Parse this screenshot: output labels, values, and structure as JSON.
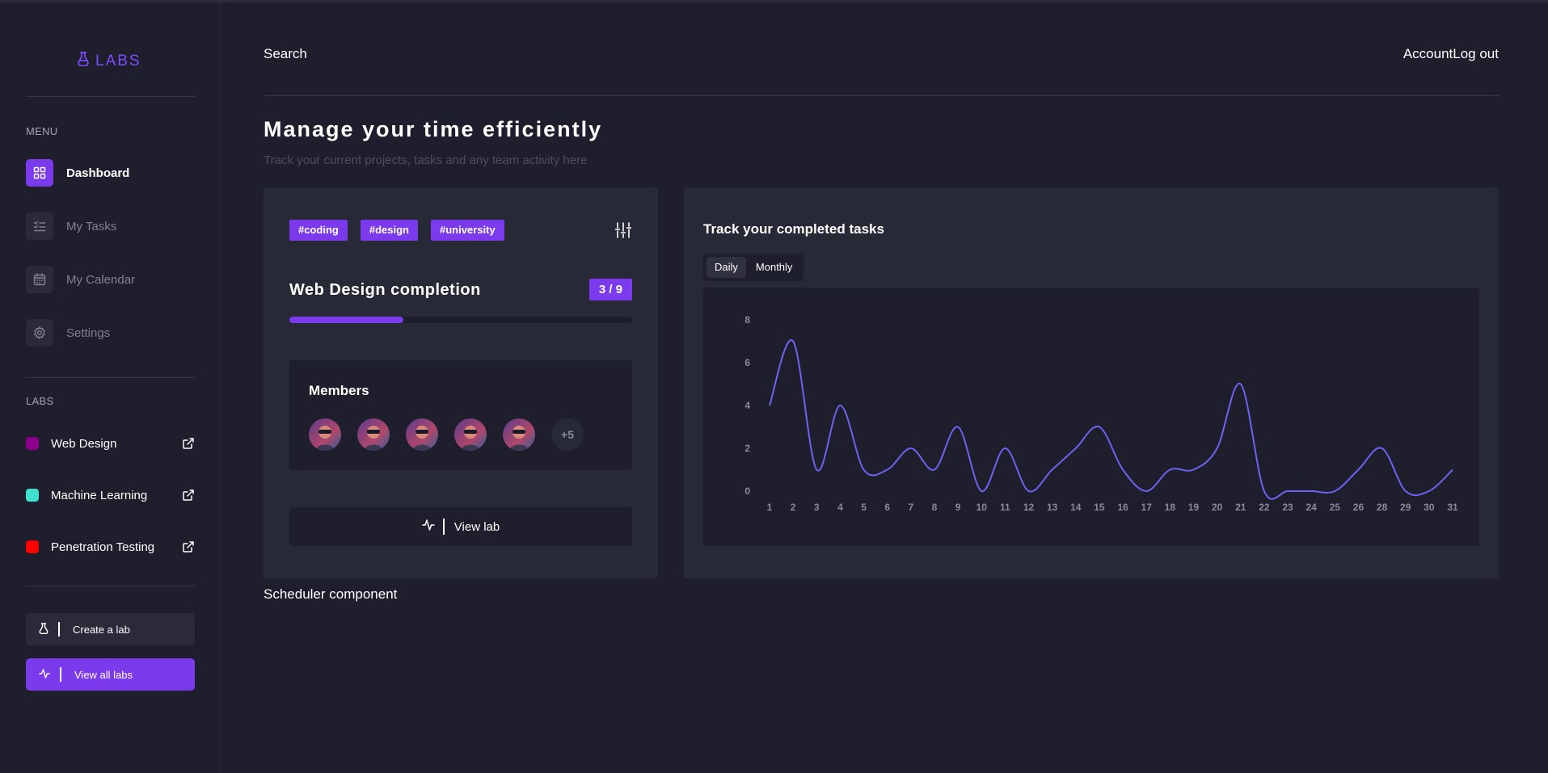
{
  "sidebar": {
    "brand": "LABS",
    "menu_label": "MENU",
    "nav": [
      {
        "label": "Dashboard",
        "icon": "grid-icon",
        "active": true
      },
      {
        "label": "My Tasks",
        "icon": "checklist-icon",
        "active": false
      },
      {
        "label": "My Calendar",
        "icon": "calendar-icon",
        "active": false
      },
      {
        "label": "Settings",
        "icon": "gear-icon",
        "active": false
      }
    ],
    "labs_label": "LABS",
    "labs": [
      {
        "label": "Web Design",
        "color": "#8b008b"
      },
      {
        "label": "Machine Learning",
        "color": "#40e0d0"
      },
      {
        "label": "Penetration Testing",
        "color": "#ff0000"
      }
    ],
    "create_lab": "Create a lab",
    "view_all_labs": "View all labs"
  },
  "header": {
    "search": "Search",
    "account": "Account",
    "logout": "Log out"
  },
  "page": {
    "title": "Manage your time efficiently",
    "subtitle": "Track your current projects, tasks and any team activity here"
  },
  "lab_card": {
    "tags": [
      "#coding",
      "#design",
      "#university"
    ],
    "title": "Web Design completion",
    "count": "3 / 9",
    "progress": 0.333,
    "members_title": "Members",
    "avatar_count": 5,
    "more_members": "+5",
    "view_lab": "View lab"
  },
  "chart_card": {
    "title": "Track your completed tasks",
    "tabs": [
      "Daily",
      "Monthly"
    ],
    "active_tab": "Daily"
  },
  "scheduler": "Scheduler component",
  "colors": {
    "accent": "#7c3aed",
    "line": "#6d63f0",
    "background": "#1e1e2d",
    "card": "#272937"
  },
  "chart_data": {
    "type": "line",
    "categories": [
      "1",
      "2",
      "3",
      "4",
      "5",
      "6",
      "7",
      "8",
      "9",
      "10",
      "11",
      "12",
      "13",
      "14",
      "15",
      "16",
      "17",
      "18",
      "19",
      "20",
      "21",
      "22",
      "23",
      "24",
      "25",
      "26",
      "28",
      "29",
      "30",
      "31"
    ],
    "values": [
      4,
      7,
      1,
      4,
      1,
      1,
      2,
      1,
      3,
      0,
      2,
      0,
      1,
      2,
      3,
      1,
      0,
      1,
      1,
      2,
      5,
      0,
      0,
      0,
      0,
      1,
      2,
      0,
      0,
      1
    ],
    "yticks": [
      0,
      2,
      4,
      6,
      8
    ],
    "ylim": [
      0,
      8
    ],
    "smooth": true,
    "grid": false,
    "legend": "none"
  }
}
